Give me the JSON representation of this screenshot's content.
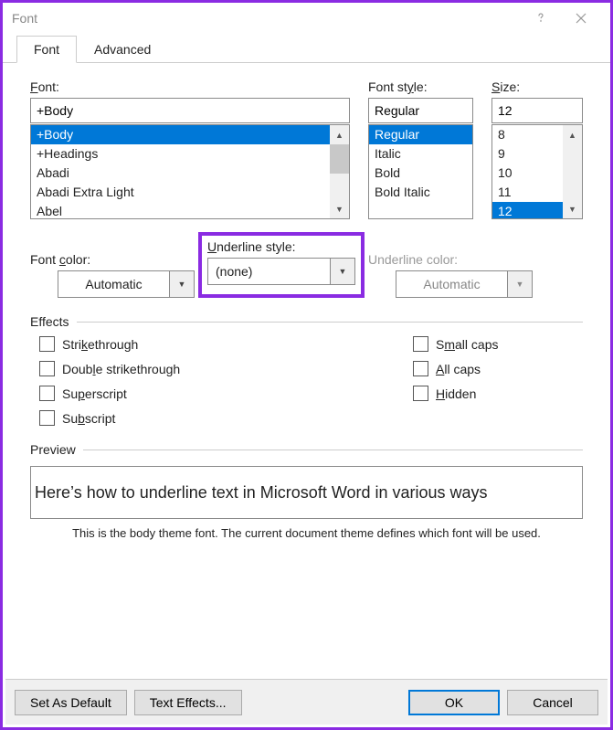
{
  "title": "Font",
  "tabs": {
    "font": "Font",
    "advanced": "Advanced"
  },
  "labels": {
    "font": "Font:",
    "style": "Font style:",
    "size": "Size:",
    "font_color": "Font color:",
    "underline_style": "Underline style:",
    "underline_color": "Underline color:",
    "effects": "Effects",
    "preview": "Preview"
  },
  "font": {
    "value": "+Body",
    "list": [
      "+Body",
      "+Headings",
      "Abadi",
      "Abadi Extra Light",
      "Abel"
    ],
    "selected_index": 0
  },
  "style": {
    "value": "Regular",
    "list": [
      "Regular",
      "Italic",
      "Bold",
      "Bold Italic"
    ],
    "selected_index": 0
  },
  "size": {
    "value": "12",
    "list": [
      "8",
      "9",
      "10",
      "11",
      "12"
    ],
    "selected_index": 4
  },
  "font_color": "Automatic",
  "underline_style": "(none)",
  "underline_color": "Automatic",
  "effects": {
    "strikethrough": "Strikethrough",
    "double_strikethrough": "Double strikethrough",
    "superscript": "Superscript",
    "subscript": "Subscript",
    "small_caps": "Small caps",
    "all_caps": "All caps",
    "hidden": "Hidden"
  },
  "preview_text": "Here’s how to underline text in Microsoft Word in various ways",
  "preview_caption": "This is the body theme font. The current document theme defines which font will be used.",
  "buttons": {
    "set_default": "Set As Default",
    "text_effects": "Text Effects...",
    "ok": "OK",
    "cancel": "Cancel"
  }
}
